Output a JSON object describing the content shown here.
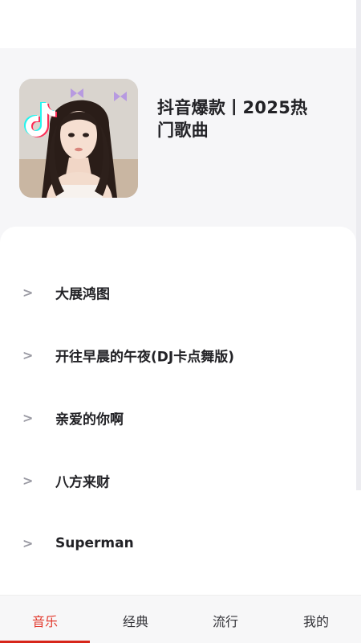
{
  "playlist": {
    "title": "抖音爆款丨2025热门歌曲",
    "cover_icon": "tiktok-logo-icon"
  },
  "songs": [
    {
      "name": "大展鸿图"
    },
    {
      "name": "开往早晨的午夜(DJ卡点舞版)"
    },
    {
      "name": "亲爱的你啊"
    },
    {
      "name": "八方来财"
    },
    {
      "name": "Superman"
    }
  ],
  "row_glyph": ">",
  "tabs": [
    {
      "label": "音乐",
      "active": true
    },
    {
      "label": "经典",
      "active": false
    },
    {
      "label": "流行",
      "active": false
    },
    {
      "label": "我的",
      "active": false
    }
  ],
  "colors": {
    "accent": "#e23a2e",
    "indicator": "#d7261a",
    "header_bg": "#f6f6f8",
    "text": "#222226",
    "chevron": "#9a9aa3"
  }
}
